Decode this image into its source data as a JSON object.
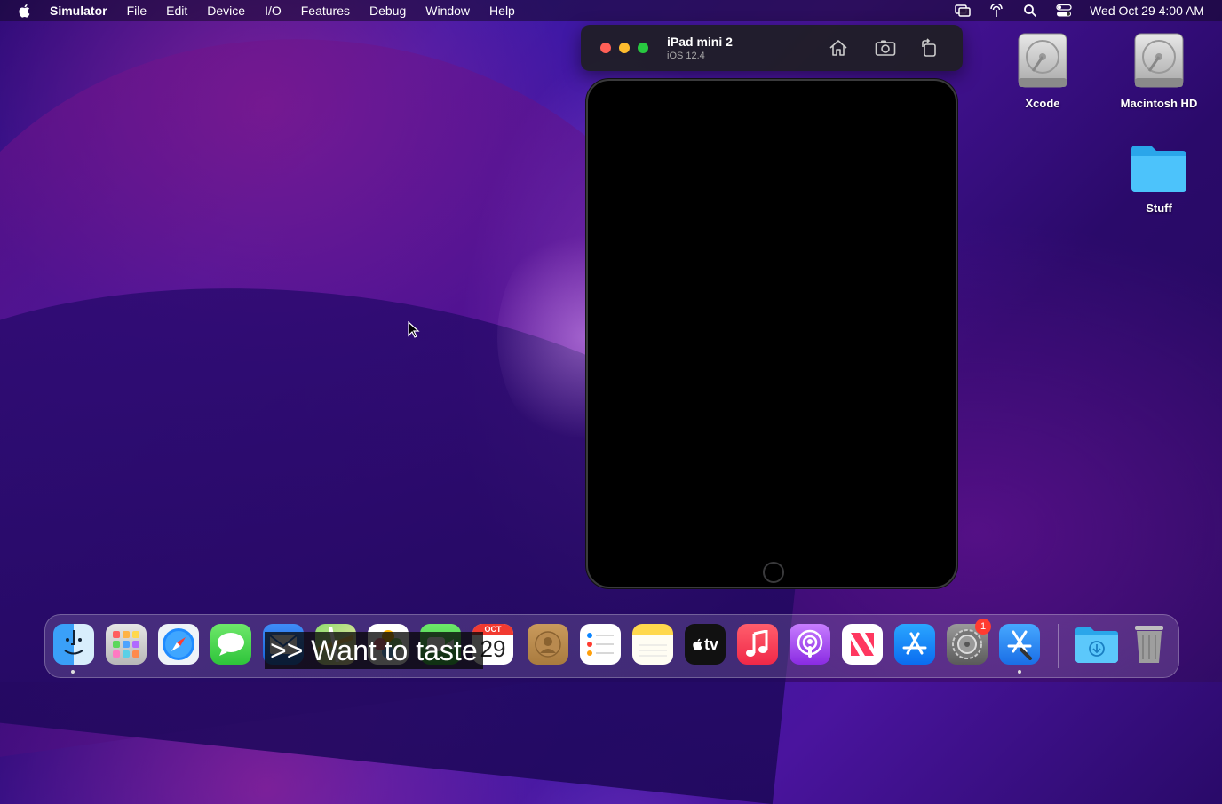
{
  "menubar": {
    "app_name": "Simulator",
    "items": [
      "File",
      "Edit",
      "Device",
      "I/O",
      "Features",
      "Debug",
      "Window",
      "Help"
    ],
    "clock": "Wed Oct 29  4:00 AM"
  },
  "simulator": {
    "device_name": "iPad mini 2",
    "os_version": "iOS 12.4"
  },
  "desktop": {
    "icons": [
      {
        "label": "Xcode",
        "icon": "hard-drive-icon"
      },
      {
        "label": "Macintosh HD",
        "icon": "hard-drive-icon"
      },
      {
        "label": "Stuff",
        "icon": "folder-icon"
      }
    ]
  },
  "dock": {
    "apps": [
      "Finder",
      "Launchpad",
      "Safari",
      "Messages",
      "Mail",
      "Maps",
      "Photos",
      "FaceTime",
      "Calendar",
      "Contacts",
      "Reminders",
      "Notes",
      "TV",
      "Music",
      "Podcasts",
      "News",
      "App Store",
      "System Preferences",
      "Xcode"
    ],
    "calendar_month": "OCT",
    "calendar_day": "29",
    "tv_label": "tv",
    "settings_badge": "1"
  },
  "caption": {
    "text": ">> Want to taste"
  },
  "colors": {
    "close": "#ff5f57",
    "minimize": "#febc2e",
    "maximize": "#28c840",
    "badge": "#ff3b30",
    "folder": "#38b6f5"
  }
}
